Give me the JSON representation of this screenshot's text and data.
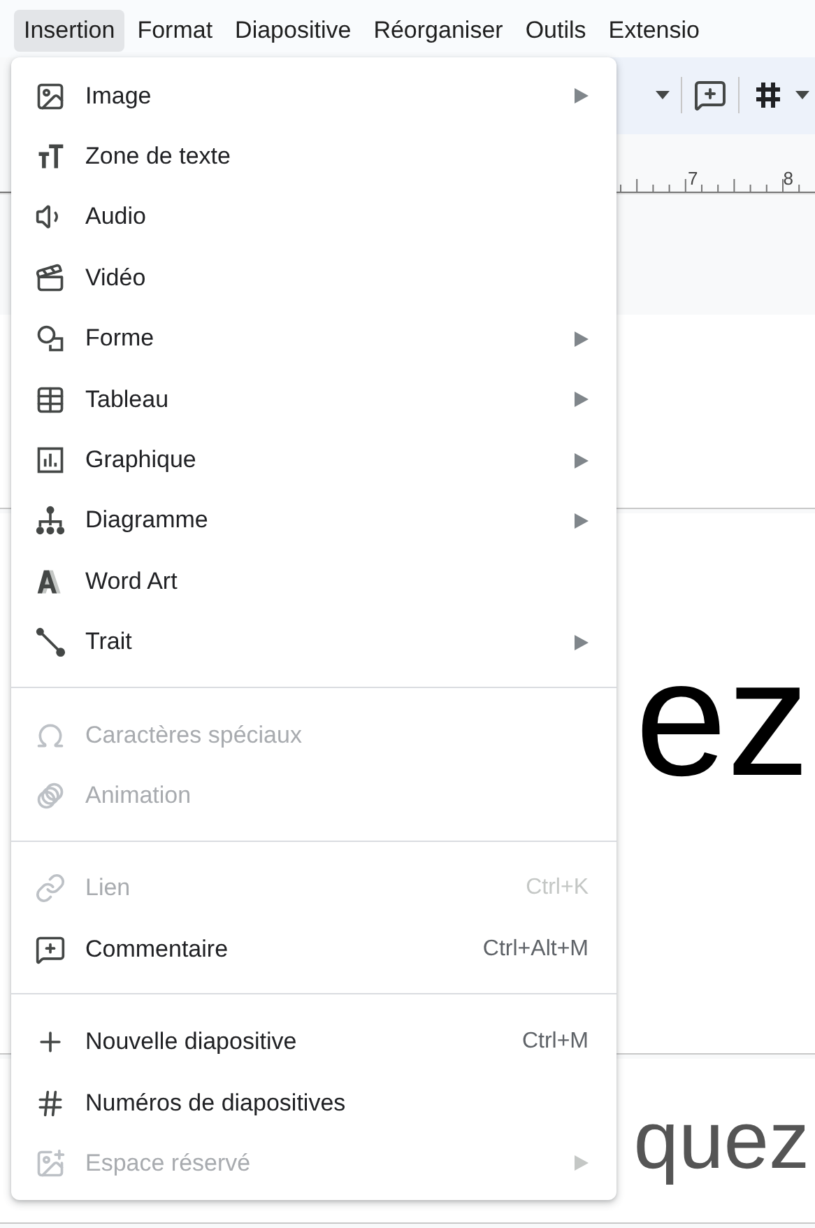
{
  "menubar": [
    {
      "label": "Insertion",
      "selected": true
    },
    {
      "label": "Format",
      "selected": false
    },
    {
      "label": "Diapositive",
      "selected": false
    },
    {
      "label": "Réorganiser",
      "selected": false
    },
    {
      "label": "Outils",
      "selected": false
    },
    {
      "label": "Extensio",
      "selected": false
    }
  ],
  "ruler": {
    "labels": [
      "7",
      "8"
    ]
  },
  "slides": [
    {
      "text": "ez"
    },
    {
      "text": "quez"
    }
  ],
  "menu": {
    "sections": [
      {
        "items": [
          {
            "label": "Image",
            "submenu": true,
            "disabled": false
          },
          {
            "label": "Zone de texte",
            "submenu": false,
            "disabled": false
          },
          {
            "label": "Audio",
            "submenu": false,
            "disabled": false
          },
          {
            "label": "Vidéo",
            "submenu": false,
            "disabled": false
          },
          {
            "label": "Forme",
            "submenu": true,
            "disabled": false
          },
          {
            "label": "Tableau",
            "submenu": true,
            "disabled": false
          },
          {
            "label": "Graphique",
            "submenu": true,
            "disabled": false
          },
          {
            "label": "Diagramme",
            "submenu": true,
            "disabled": false
          },
          {
            "label": "Word Art",
            "submenu": false,
            "disabled": false
          },
          {
            "label": "Trait",
            "submenu": true,
            "disabled": false
          }
        ]
      },
      {
        "items": [
          {
            "label": "Caractères spéciaux",
            "submenu": false,
            "disabled": true
          },
          {
            "label": "Animation",
            "submenu": false,
            "disabled": true
          }
        ]
      },
      {
        "items": [
          {
            "label": "Lien",
            "shortcut": "Ctrl+K",
            "submenu": false,
            "disabled": true
          },
          {
            "label": "Commentaire",
            "shortcut": "Ctrl+Alt+M",
            "submenu": false,
            "disabled": false
          }
        ]
      },
      {
        "items": [
          {
            "label": "Nouvelle diapositive",
            "shortcut": "Ctrl+M",
            "submenu": false,
            "disabled": false
          },
          {
            "label": "Numéros de diapositives",
            "submenu": false,
            "disabled": false
          },
          {
            "label": "Espace réservé",
            "submenu": true,
            "disabled": true
          }
        ]
      }
    ]
  }
}
